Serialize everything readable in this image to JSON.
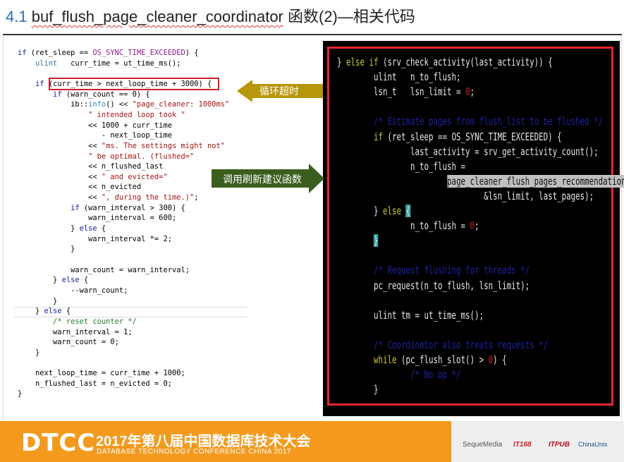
{
  "title": {
    "number": "4.1",
    "function": "buf_flush_page_cleaner_coordinator",
    "suffix": " 函数(2)—相关代码"
  },
  "callouts": {
    "loop_timeout": "循环超时",
    "call_recommendation": "调用刷新建议函数",
    "loop_color": "#b8960c",
    "call_color": "#3b5e1f"
  },
  "left_code": [
    [
      [
        "if ",
        "kw"
      ],
      [
        "(ret_sleep == ",
        ""
      ],
      [
        "OS_SYNC_TIME_EXCEEDED",
        "cst"
      ],
      [
        ") {",
        ""
      ]
    ],
    [
      [
        "    ",
        ""
      ],
      [
        "ulint",
        "ty"
      ],
      [
        "   curr_time = ut_time_ms();",
        ""
      ]
    ],
    [],
    [
      [
        "    ",
        ""
      ],
      [
        "if ",
        "kw"
      ],
      [
        "(curr_time > next_loop_time + 3000) {",
        ""
      ]
    ],
    [
      [
        "        ",
        ""
      ],
      [
        "if ",
        "kw"
      ],
      [
        "(warn_count == 0) {",
        ""
      ]
    ],
    [
      [
        "            ib::",
        ""
      ],
      [
        "info",
        "fnc"
      ],
      [
        "() << ",
        ""
      ],
      [
        "\"page_cleaner: 1000ms\"",
        "str"
      ]
    ],
    [
      [
        "                ",
        ""
      ],
      [
        "\" intended loop took \"",
        "str"
      ]
    ],
    [
      [
        "                << 1000 + curr_time",
        ""
      ]
    ],
    [
      [
        "                   - next_loop_time",
        ""
      ]
    ],
    [
      [
        "                << ",
        ""
      ],
      [
        "\"ms. The settings might not\"",
        "str"
      ]
    ],
    [
      [
        "                ",
        ""
      ],
      [
        "\" be optimal. (flushed=\"",
        "str"
      ]
    ],
    [
      [
        "                << n_flushed_last",
        ""
      ]
    ],
    [
      [
        "                << ",
        ""
      ],
      [
        "\" and evicted=\"",
        "str"
      ]
    ],
    [
      [
        "                << n_evicted",
        ""
      ]
    ],
    [
      [
        "                << ",
        ""
      ],
      [
        "\", during the time.)\"",
        "str"
      ],
      [
        ";",
        ""
      ]
    ],
    [
      [
        "            ",
        ""
      ],
      [
        "if ",
        "kw"
      ],
      [
        "(warn_interval > 300) {",
        ""
      ]
    ],
    [
      [
        "                warn_interval = 600;",
        ""
      ]
    ],
    [
      [
        "            } ",
        ""
      ],
      [
        "else ",
        "kw"
      ],
      [
        "{",
        ""
      ]
    ],
    [
      [
        "                warn_interval *= 2;",
        ""
      ]
    ],
    [
      [
        "            }",
        ""
      ]
    ],
    [],
    [
      [
        "            warn_count = warn_interval;",
        ""
      ]
    ],
    [
      [
        "        } ",
        ""
      ],
      [
        "else ",
        "kw"
      ],
      [
        "{",
        ""
      ]
    ],
    [
      [
        "            --warn_count;",
        ""
      ]
    ],
    [
      [
        "        }",
        ""
      ]
    ],
    [
      [
        "    } ",
        ""
      ],
      [
        "else ",
        "kw"
      ],
      [
        "{",
        ""
      ]
    ],
    [
      [
        "        ",
        ""
      ],
      [
        "/* reset counter */",
        "cm"
      ]
    ],
    [
      [
        "        warn_interval = 1;",
        ""
      ]
    ],
    [
      [
        "        warn_count = 0;",
        ""
      ]
    ],
    [
      [
        "    }",
        ""
      ]
    ],
    [],
    [
      [
        "    next_loop_time = curr_time + 1000;",
        ""
      ]
    ],
    [
      [
        "    n_flushed_last = n_evicted = 0;",
        ""
      ]
    ],
    [
      [
        "}",
        ""
      ]
    ]
  ],
  "right_code": [
    [
      [
        "} ",
        ""
      ],
      [
        "else if ",
        "r-kw"
      ],
      [
        "(srv_check_activity(last_activity)) {",
        ""
      ]
    ],
    [
      [
        "        ulint   n_to_flush;",
        ""
      ]
    ],
    [
      [
        "        lsn_t   lsn_limit = ",
        ""
      ],
      [
        "0",
        "r-num"
      ],
      [
        ";",
        ""
      ]
    ],
    [],
    [
      [
        "        ",
        ""
      ],
      [
        "/* Estimate pages from flush_list to be flushed */",
        "r-cm"
      ]
    ],
    [
      [
        "        ",
        ""
      ],
      [
        "if ",
        "r-kw"
      ],
      [
        "(ret_sleep == OS_SYNC_TIME_EXCEEDED) {",
        ""
      ]
    ],
    [
      [
        "                last_activity = srv_get_activity_count();",
        ""
      ]
    ],
    [
      [
        "                n_to_flush =",
        ""
      ]
    ],
    [
      [
        "                        ",
        ""
      ],
      [
        "page_cleaner_flush_pages_recommendation",
        "r-sel"
      ],
      [
        "(",
        ""
      ]
    ],
    [
      [
        "                                &lsn_limit, last_pages);",
        ""
      ]
    ],
    [
      [
        "        } ",
        ""
      ],
      [
        "else ",
        "r-kw"
      ],
      [
        "{",
        "r-cur"
      ]
    ],
    [
      [
        "                n_to_flush = ",
        ""
      ],
      [
        "0",
        "r-num"
      ],
      [
        ";",
        ""
      ]
    ],
    [
      [
        "        ",
        ""
      ],
      [
        "}",
        "r-cur"
      ]
    ],
    [],
    [
      [
        "        ",
        ""
      ],
      [
        "/* Request flushing for threads */",
        "r-cm"
      ]
    ],
    [
      [
        "        pc_request(n_to_flush, lsn_limit);",
        ""
      ]
    ],
    [],
    [
      [
        "        ulint tm = ut_time_ms();",
        ""
      ]
    ],
    [],
    [
      [
        "        ",
        ""
      ],
      [
        "/* Coordinator also treats requests */",
        "r-cm"
      ]
    ],
    [
      [
        "        ",
        ""
      ],
      [
        "while ",
        "r-kw"
      ],
      [
        "(pc_flush_slot() > ",
        ""
      ],
      [
        "0",
        "r-num"
      ],
      [
        ") {",
        ""
      ]
    ],
    [
      [
        "                ",
        ""
      ],
      [
        "/* No op */",
        "r-cm"
      ]
    ],
    [
      [
        "        }",
        ""
      ]
    ]
  ],
  "footer": {
    "logo": "DTCC",
    "conference_cn": "2017年第八届中国数据库技术大会",
    "conference_en": "DATABASE TECHNOLOGY CONFERENCE CHINA 2017",
    "sponsor_1": "SequeMedia",
    "sponsor_2": "IT168",
    "sponsor_3": "ITPUB",
    "sponsor_4": "ChinaUnix",
    "brand_color": "#f39a1e"
  }
}
